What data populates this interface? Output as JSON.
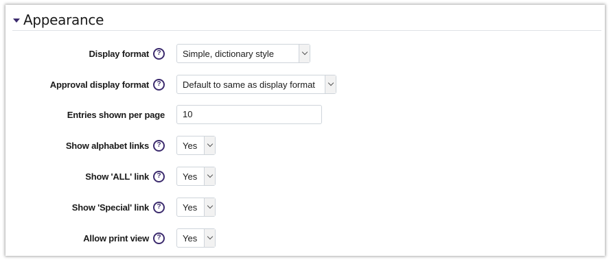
{
  "section": {
    "title": "Appearance",
    "icon": "caret-down-icon"
  },
  "help_icon_glyph": "?",
  "rows": [
    {
      "label": "Display format",
      "type": "select",
      "value": "Simple, dictionary style",
      "help": true
    },
    {
      "label": "Approval display format",
      "type": "select",
      "value": "Default to same as display format",
      "help": true
    },
    {
      "label": "Entries shown per page",
      "type": "text",
      "value": "10",
      "help": false
    },
    {
      "label": "Show alphabet links",
      "type": "select",
      "value": "Yes",
      "help": true
    },
    {
      "label": "Show 'ALL' link",
      "type": "select",
      "value": "Yes",
      "help": true
    },
    {
      "label": "Show 'Special' link",
      "type": "select",
      "value": "Yes",
      "help": true
    },
    {
      "label": "Allow print view",
      "type": "select",
      "value": "Yes",
      "help": true
    }
  ],
  "colors": {
    "accent": "#3b2a6d",
    "border": "#ced4da"
  }
}
